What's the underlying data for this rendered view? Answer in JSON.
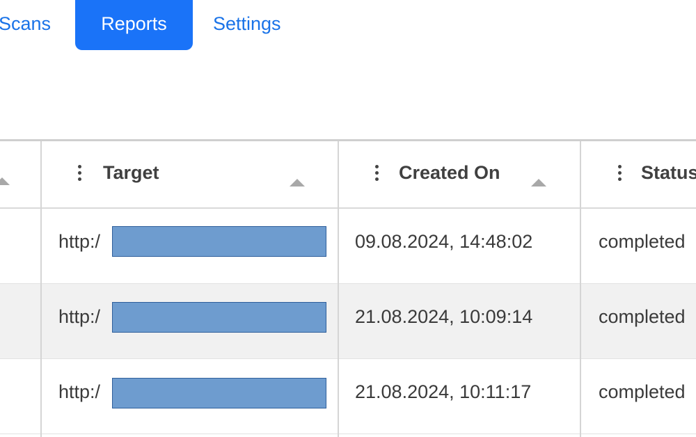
{
  "nav": {
    "tabs": [
      {
        "label": "Scans",
        "active": false
      },
      {
        "label": "Reports",
        "active": true
      },
      {
        "label": "Settings",
        "active": false
      }
    ],
    "accent_color": "#1a73f8"
  },
  "table": {
    "columns": [
      {
        "label": "Target",
        "sort": "ascending"
      },
      {
        "label": "Created On",
        "sort": "ascending"
      },
      {
        "label": "Status",
        "sort": ""
      }
    ],
    "rows": [
      {
        "target": "http:/",
        "created_on": "09.08.2024, 14:48:02",
        "status": "completed"
      },
      {
        "target": "http:/",
        "created_on": "21.08.2024, 10:09:14",
        "status": "completed"
      },
      {
        "target": "http:/",
        "created_on": "21.08.2024, 10:11:17",
        "status": "completed"
      }
    ]
  }
}
